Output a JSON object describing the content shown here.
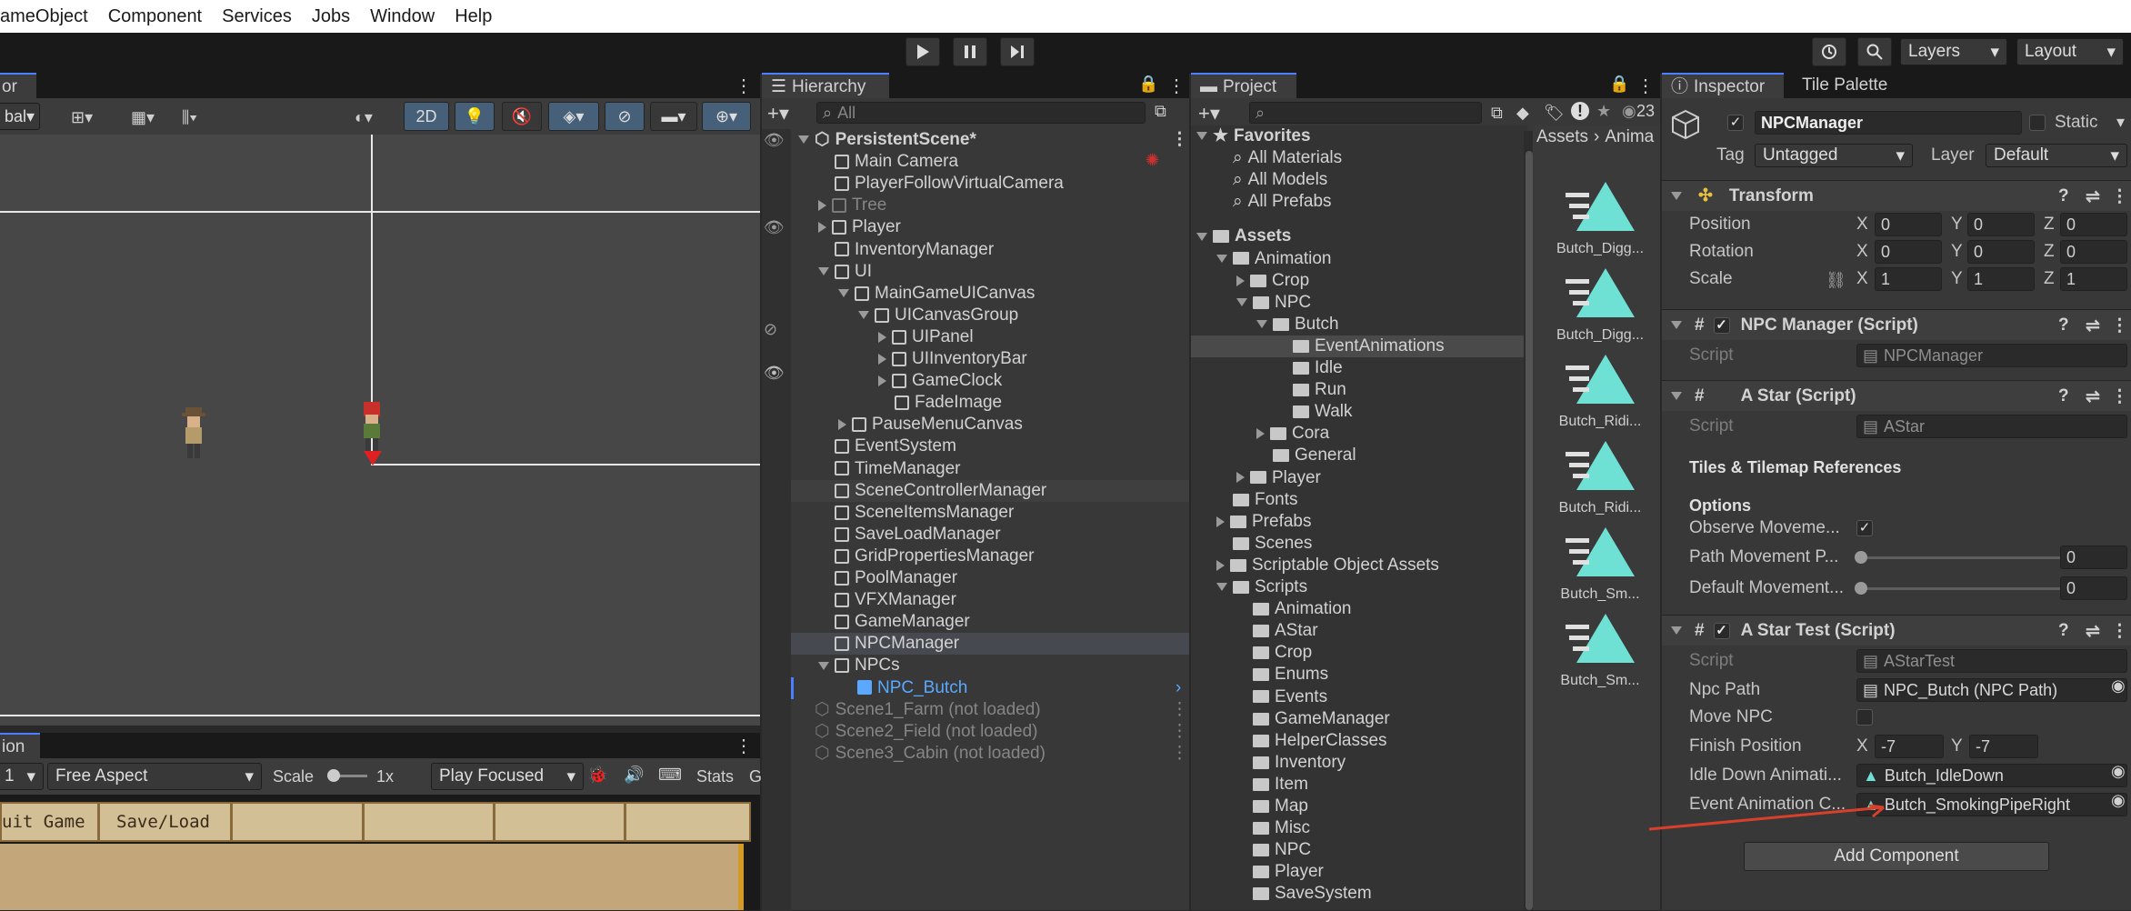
{
  "menu": [
    "ameObject",
    "Component",
    "Services",
    "Jobs",
    "Window",
    "Help"
  ],
  "toolbar": {
    "layers": "Layers",
    "layout": "Layout"
  },
  "scene": {
    "tab": "or",
    "mode_2d": "2D",
    "toolbar_left": "bal"
  },
  "game": {
    "tab": "ion",
    "display": "1",
    "aspect": "Free Aspect",
    "scale_label": "Scale",
    "scale_value": "1x",
    "play_mode": "Play Focused",
    "stats": "Stats",
    "g": "G",
    "buttons": [
      "uit Game",
      "Save/Load"
    ]
  },
  "hierarchy": {
    "tab": "Hierarchy",
    "search_placeholder": "All",
    "rows": [
      {
        "label": "PersistentScene*",
        "indent": 0,
        "icon": "scene",
        "arrow": "down",
        "bold": true,
        "menu": true
      },
      {
        "label": "Main Camera",
        "indent": 1,
        "icon": "cube"
      },
      {
        "label": "PlayerFollowVirtualCamera",
        "indent": 1,
        "icon": "cube"
      },
      {
        "label": "Tree",
        "indent": 1,
        "icon": "cube",
        "arrow": "right",
        "grey": true
      },
      {
        "label": "Player",
        "indent": 1,
        "icon": "cube",
        "arrow": "right"
      },
      {
        "label": "InventoryManager",
        "indent": 1,
        "icon": "cube"
      },
      {
        "label": "UI",
        "indent": 1,
        "icon": "cube",
        "arrow": "down"
      },
      {
        "label": "MainGameUICanvas",
        "indent": 2,
        "icon": "cube",
        "arrow": "down"
      },
      {
        "label": "UICanvasGroup",
        "indent": 3,
        "icon": "cube",
        "arrow": "down"
      },
      {
        "label": "UIPanel",
        "indent": 4,
        "icon": "cube",
        "arrow": "right"
      },
      {
        "label": "UIInventoryBar",
        "indent": 4,
        "icon": "cube",
        "arrow": "right"
      },
      {
        "label": "GameClock",
        "indent": 4,
        "icon": "cube",
        "arrow": "right"
      },
      {
        "label": "FadeImage",
        "indent": 4,
        "icon": "cube"
      },
      {
        "label": "PauseMenuCanvas",
        "indent": 2,
        "icon": "cube",
        "arrow": "right"
      },
      {
        "label": "EventSystem",
        "indent": 1,
        "icon": "cube"
      },
      {
        "label": "TimeManager",
        "indent": 1,
        "icon": "cube"
      },
      {
        "label": "SceneControllerManager",
        "indent": 1,
        "icon": "cube",
        "hl": true
      },
      {
        "label": "SceneItemsManager",
        "indent": 1,
        "icon": "cube"
      },
      {
        "label": "SaveLoadManager",
        "indent": 1,
        "icon": "cube"
      },
      {
        "label": "GridPropertiesManager",
        "indent": 1,
        "icon": "cube"
      },
      {
        "label": "PoolManager",
        "indent": 1,
        "icon": "cube"
      },
      {
        "label": "VFXManager",
        "indent": 1,
        "icon": "cube"
      },
      {
        "label": "GameManager",
        "indent": 1,
        "icon": "cube"
      },
      {
        "label": "NPCManager",
        "indent": 1,
        "icon": "cube",
        "sel": true
      },
      {
        "label": "NPCs",
        "indent": 1,
        "icon": "cube",
        "arrow": "down"
      },
      {
        "label": "NPC_Butch",
        "indent": 2,
        "icon": "prefab",
        "blue": true
      },
      {
        "label": "Scene1_Farm (not loaded)",
        "indent": 0,
        "icon": "scene",
        "grey": true,
        "menu": true
      },
      {
        "label": "Scene2_Field (not loaded)",
        "indent": 0,
        "icon": "scene",
        "grey": true,
        "menu": true
      },
      {
        "label": "Scene3_Cabin (not loaded)",
        "indent": 0,
        "icon": "scene",
        "grey": true,
        "menu": true
      }
    ]
  },
  "project": {
    "tab": "Project",
    "count": "23",
    "breadcrumb": [
      "Assets",
      "Anima"
    ],
    "tree": [
      {
        "label": "Favorites",
        "indent": 0,
        "type": "star",
        "arrow": "down",
        "bold": true
      },
      {
        "label": "All Materials",
        "indent": 1,
        "type": "search"
      },
      {
        "label": "All Models",
        "indent": 1,
        "type": "search"
      },
      {
        "label": "All Prefabs",
        "indent": 1,
        "type": "search"
      },
      {
        "label": "",
        "indent": 0,
        "type": "gap"
      },
      {
        "label": "Assets",
        "indent": 0,
        "type": "folder",
        "arrow": "down",
        "bold": true
      },
      {
        "label": "Animation",
        "indent": 1,
        "type": "folder",
        "arrow": "down"
      },
      {
        "label": "Crop",
        "indent": 2,
        "type": "folder",
        "arrow": "right"
      },
      {
        "label": "NPC",
        "indent": 2,
        "type": "folder",
        "arrow": "down"
      },
      {
        "label": "Butch",
        "indent": 3,
        "type": "folder",
        "arrow": "down"
      },
      {
        "label": "EventAnimations",
        "indent": 4,
        "type": "folder",
        "sel": true
      },
      {
        "label": "Idle",
        "indent": 4,
        "type": "folder"
      },
      {
        "label": "Run",
        "indent": 4,
        "type": "folder"
      },
      {
        "label": "Walk",
        "indent": 4,
        "type": "folder"
      },
      {
        "label": "Cora",
        "indent": 3,
        "type": "folder",
        "arrow": "right"
      },
      {
        "label": "General",
        "indent": 3,
        "type": "folder"
      },
      {
        "label": "Player",
        "indent": 2,
        "type": "folder",
        "arrow": "right"
      },
      {
        "label": "Fonts",
        "indent": 1,
        "type": "folder"
      },
      {
        "label": "Prefabs",
        "indent": 1,
        "type": "folder",
        "arrow": "right"
      },
      {
        "label": "Scenes",
        "indent": 1,
        "type": "folder"
      },
      {
        "label": "Scriptable Object Assets",
        "indent": 1,
        "type": "folder",
        "arrow": "right"
      },
      {
        "label": "Scripts",
        "indent": 1,
        "type": "folder",
        "arrow": "down"
      },
      {
        "label": "Animation",
        "indent": 2,
        "type": "folder"
      },
      {
        "label": "AStar",
        "indent": 2,
        "type": "folder"
      },
      {
        "label": "Crop",
        "indent": 2,
        "type": "folder"
      },
      {
        "label": "Enums",
        "indent": 2,
        "type": "folder"
      },
      {
        "label": "Events",
        "indent": 2,
        "type": "folder"
      },
      {
        "label": "GameManager",
        "indent": 2,
        "type": "folder"
      },
      {
        "label": "HelperClasses",
        "indent": 2,
        "type": "folder"
      },
      {
        "label": "Inventory",
        "indent": 2,
        "type": "folder"
      },
      {
        "label": "Item",
        "indent": 2,
        "type": "folder"
      },
      {
        "label": "Map",
        "indent": 2,
        "type": "folder"
      },
      {
        "label": "Misc",
        "indent": 2,
        "type": "folder"
      },
      {
        "label": "NPC",
        "indent": 2,
        "type": "folder"
      },
      {
        "label": "Player",
        "indent": 2,
        "type": "folder"
      },
      {
        "label": "SaveSystem",
        "indent": 2,
        "type": "folder"
      }
    ],
    "assets": [
      "Butch_Digg...",
      "Butch_Digg...",
      "Butch_Ridi...",
      "Butch_Ridi...",
      "Butch_Sm...",
      "Butch_Sm..."
    ]
  },
  "inspector": {
    "tab": "Inspector",
    "tab2": "Tile Palette",
    "object_name": "NPCManager",
    "static_label": "Static",
    "tag_label": "Tag",
    "tag_value": "Untagged",
    "layer_label": "Layer",
    "layer_value": "Default",
    "transform": {
      "title": "Transform",
      "rows": [
        {
          "label": "Position",
          "x": "0",
          "y": "0",
          "z": "0"
        },
        {
          "label": "Rotation",
          "x": "0",
          "y": "0",
          "z": "0"
        },
        {
          "label": "Scale",
          "x": "1",
          "y": "1",
          "z": "1"
        }
      ]
    },
    "npc_manager": {
      "title": "NPC Manager (Script)",
      "script_label": "Script",
      "script_value": "NPCManager"
    },
    "astar": {
      "title": "A Star (Script)",
      "script_label": "Script",
      "script_value": "AStar",
      "section1": "Tiles & Tilemap References",
      "section2": "Options",
      "observe_label": "Observe Moveme...",
      "path_label": "Path Movement P...",
      "path_value": "0",
      "default_label": "Default Movement...",
      "default_value": "0"
    },
    "astar_test": {
      "title": "A Star Test (Script)",
      "script_label": "Script",
      "script_value": "AStarTest",
      "npcpath_label": "Npc Path",
      "npcpath_value": "NPC_Butch (NPC Path)",
      "move_label": "Move NPC",
      "finish_label": "Finish Position",
      "finish_x": "-7",
      "finish_y": "-7",
      "idle_label": "Idle Down Animati...",
      "idle_value": "Butch_IdleDown",
      "event_label": "Event Animation C...",
      "event_value": "Butch_SmokingPipeRight"
    },
    "add_component": "Add Component"
  },
  "colors": {
    "accent": "#4c7fff",
    "anim_icon": "#6fe0d4",
    "annotation_arrow": "#d8402c",
    "selected": "#2c5d87"
  }
}
